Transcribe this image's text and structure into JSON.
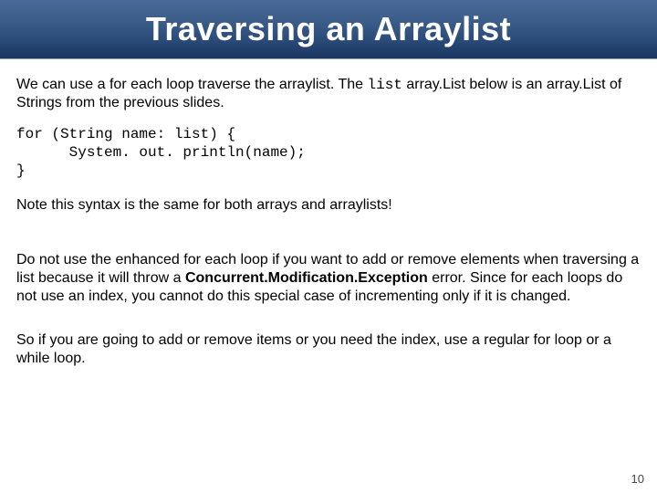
{
  "title": "Traversing an Arraylist",
  "intro_before_code": "We can use a for each loop traverse the arraylist. The ",
  "intro_code_word": "list",
  "intro_after_code": " array.List below is an array.List of Strings from the previous slides.",
  "code": "for (String name: list) {\n      System. out. println(name);\n}",
  "note": "Note this syntax is the same for both arrays and arraylists!",
  "warn_before_bold": "Do not use the enhanced for each loop if you want to add or remove elements when traversing a list because it will throw a ",
  "warn_bold": "Concurrent.Modification.Exception",
  "warn_after_bold": " error. Since for each loops do not use an index, you cannot do this special case of incrementing only if it is changed.",
  "conclusion": "So if you are going to add or remove items or you need the index, use a regular for loop or a while loop.",
  "page_number": "10"
}
